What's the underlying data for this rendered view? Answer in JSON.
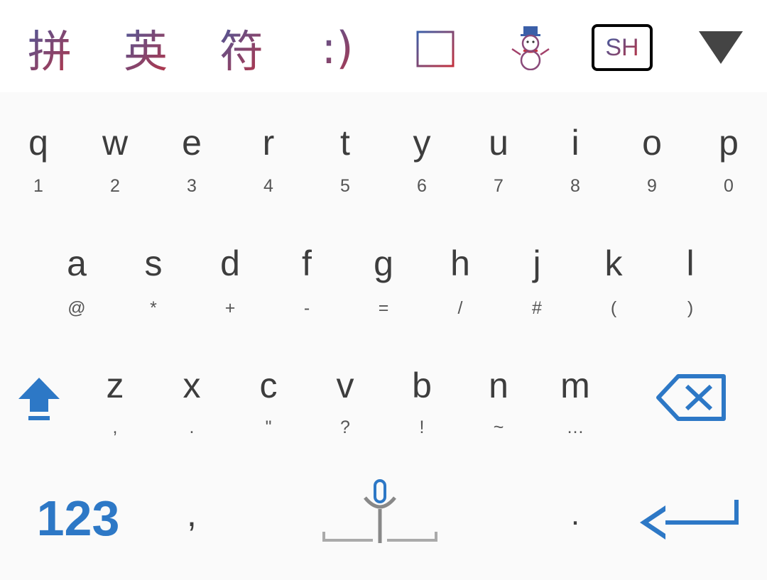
{
  "toolbar": {
    "pinyin": "拼",
    "english": "英",
    "symbols": "符",
    "emoticon": ":)",
    "clipboard_icon": "clipboard-icon",
    "snowman_icon": "snowman-icon",
    "sh_label": "SH",
    "collapse_icon": "triangle-down-icon",
    "gradient_colors": [
      "#3b5fa8",
      "#c2303d"
    ]
  },
  "keyboard": {
    "row1": [
      {
        "main": "q",
        "sub": "1"
      },
      {
        "main": "w",
        "sub": "2"
      },
      {
        "main": "e",
        "sub": "3"
      },
      {
        "main": "r",
        "sub": "4"
      },
      {
        "main": "t",
        "sub": "5"
      },
      {
        "main": "y",
        "sub": "6"
      },
      {
        "main": "u",
        "sub": "7"
      },
      {
        "main": "i",
        "sub": "8"
      },
      {
        "main": "o",
        "sub": "9"
      },
      {
        "main": "p",
        "sub": "0"
      }
    ],
    "row2": [
      {
        "main": "a",
        "sub": "@"
      },
      {
        "main": "s",
        "sub": "*"
      },
      {
        "main": "d",
        "sub": "+"
      },
      {
        "main": "f",
        "sub": "-"
      },
      {
        "main": "g",
        "sub": "="
      },
      {
        "main": "h",
        "sub": "/"
      },
      {
        "main": "j",
        "sub": "#"
      },
      {
        "main": "k",
        "sub": "("
      },
      {
        "main": "l",
        "sub": ")"
      }
    ],
    "row3": [
      {
        "main": "z",
        "sub": ","
      },
      {
        "main": "x",
        "sub": "."
      },
      {
        "main": "c",
        "sub": "\""
      },
      {
        "main": "v",
        "sub": "?"
      },
      {
        "main": "b",
        "sub": "!"
      },
      {
        "main": "n",
        "sub": "~"
      },
      {
        "main": "m",
        "sub": "…"
      }
    ],
    "bottom": {
      "num_label": "123",
      "comma": ",",
      "period": ".",
      "mic_icon": "microphone-icon",
      "enter_icon": "enter-arrow-icon",
      "shift_icon": "shift-arrow-icon",
      "backspace_icon": "backspace-icon"
    },
    "accent_color": "#2d78c6"
  }
}
